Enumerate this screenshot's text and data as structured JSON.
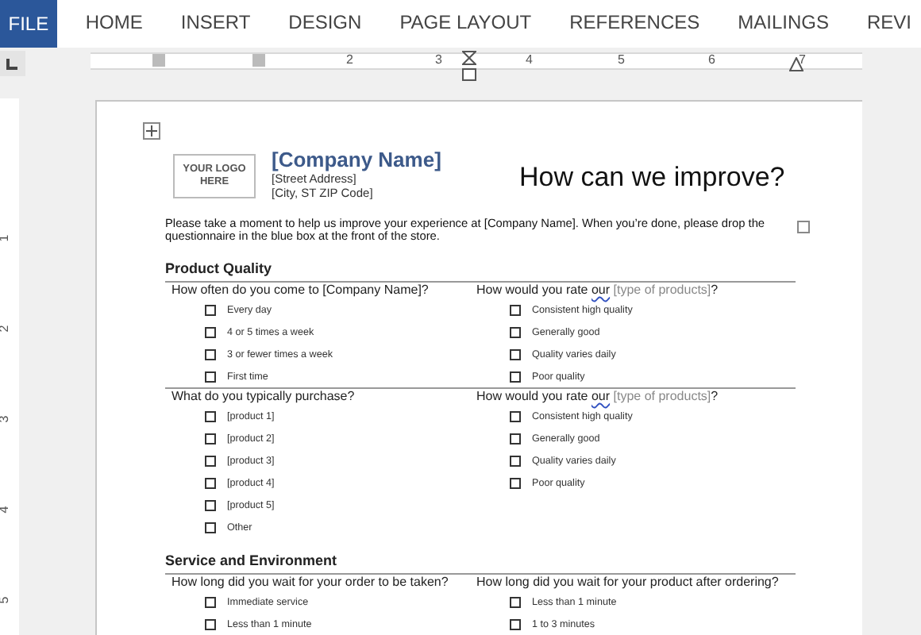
{
  "ribbon": {
    "file_tab": "FILE",
    "tabs": [
      {
        "label": "HOME",
        "selected": false
      },
      {
        "label": "INSERT",
        "selected": false
      },
      {
        "label": "DESIGN",
        "selected": false
      },
      {
        "label": "PAGE LAYOUT",
        "selected": false
      },
      {
        "label": "REFERENCES",
        "selected": false
      },
      {
        "label": "MAILINGS",
        "selected": false
      },
      {
        "label": "REVI",
        "selected": false
      }
    ]
  },
  "horizontal_ruler": {
    "marks": [
      "2",
      "3",
      "4",
      "5",
      "6",
      "7"
    ]
  },
  "vertical_ruler": {
    "marks": [
      "1",
      "2",
      "3",
      "4",
      "5"
    ]
  },
  "document": {
    "logo": "YOUR LOGO HERE",
    "company_name": "[Company Name]",
    "address_lines": [
      "[Street Address]",
      "[City, ST  ZIP Code]"
    ],
    "title": "How can we improve?",
    "intro": "Please take a moment to help us improve your experience at [Company Name]. When you’re done, please drop the questionnaire in the blue box at the front of the store.",
    "intro_checkbox": {
      "checked": false
    },
    "sections": [
      {
        "heading": "Product Quality",
        "rows": [
          {
            "left": {
              "question": [
                {
                  "text": "How often do you come to [Company Name]?"
                }
              ],
              "options": [
                {
                  "label": "Every day",
                  "checked": false
                },
                {
                  "label": "4 or 5 times a week",
                  "checked": false
                },
                {
                  "label": "3 or fewer times a week",
                  "checked": false
                },
                {
                  "label": "First time",
                  "checked": false
                }
              ]
            },
            "right": {
              "question": [
                {
                  "text": "How would you rate "
                },
                {
                  "text": "our",
                  "kind": "flagged"
                },
                {
                  "text": " [type of products]",
                  "kind": "field"
                },
                {
                  "text": "?"
                }
              ],
              "options": [
                {
                  "label": "Consistent high quality",
                  "checked": false
                },
                {
                  "label": "Generally good",
                  "checked": false
                },
                {
                  "label": "Quality varies daily",
                  "checked": false
                },
                {
                  "label": "Poor quality",
                  "checked": false
                }
              ]
            }
          },
          {
            "left": {
              "question": [
                {
                  "text": "What do you typically purchase?"
                }
              ],
              "options": [
                {
                  "label": "[product 1]",
                  "checked": false
                },
                {
                  "label": "[product 2]",
                  "checked": false
                },
                {
                  "label": "[product 3]",
                  "checked": false
                },
                {
                  "label": "[product 4]",
                  "checked": false
                },
                {
                  "label": "[product 5]",
                  "checked": false
                },
                {
                  "label": "Other",
                  "checked": false
                }
              ]
            },
            "right": {
              "question": [
                {
                  "text": "How would you rate "
                },
                {
                  "text": "our",
                  "kind": "flagged"
                },
                {
                  "text": " [type of products]",
                  "kind": "field"
                },
                {
                  "text": "?"
                }
              ],
              "options": [
                {
                  "label": "Consistent high quality",
                  "checked": false
                },
                {
                  "label": "Generally good",
                  "checked": false
                },
                {
                  "label": "Quality varies daily",
                  "checked": false
                },
                {
                  "label": "Poor quality",
                  "checked": false
                }
              ]
            }
          }
        ]
      },
      {
        "heading": "Service and Environment",
        "rows": [
          {
            "left": {
              "question": [
                {
                  "text": "How long did you wait for your order to be taken?"
                }
              ],
              "options": [
                {
                  "label": "Immediate service",
                  "checked": false
                },
                {
                  "label": "Less than 1 minute",
                  "checked": false
                }
              ]
            },
            "right": {
              "question": [
                {
                  "text": "How long did you wait for your product after ordering?"
                }
              ],
              "options": [
                {
                  "label": "Less than 1 minute",
                  "checked": false
                },
                {
                  "label": "1 to 3 minutes",
                  "checked": false
                }
              ]
            }
          }
        ]
      }
    ]
  }
}
